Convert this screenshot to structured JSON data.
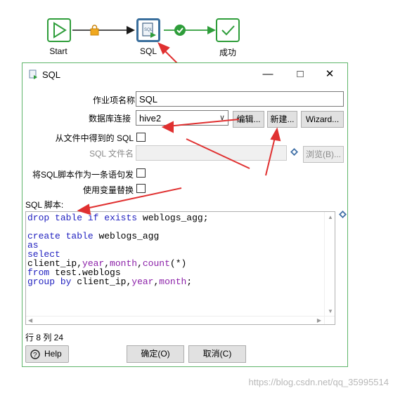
{
  "workflow": {
    "nodes": [
      {
        "label": "Start"
      },
      {
        "label": "SQL"
      },
      {
        "label": "成功"
      }
    ]
  },
  "dialog": {
    "title": "SQL",
    "fields": {
      "job_name_label": "作业项名称",
      "job_name_value": "SQL",
      "db_conn_label": "数据库连接",
      "db_conn_value": "hive2",
      "edit_button": "编辑...",
      "new_button": "新建...",
      "wizard_button": "Wizard...",
      "sql_from_file_label": "从文件中得到的 SQL",
      "sql_filename_label": "SQL 文件名",
      "browse_button": "浏览(B)...",
      "single_statement_label": "将SQL脚本作为一条语句发",
      "use_variables_label": "使用变量替换",
      "script_label": "SQL 脚本:"
    },
    "editor": {
      "lines": [
        [
          [
            "kw",
            "drop"
          ],
          [
            "t",
            " "
          ],
          [
            "kw",
            "table"
          ],
          [
            "t",
            " "
          ],
          [
            "kw",
            "if"
          ],
          [
            "t",
            " "
          ],
          [
            "kw",
            "exists"
          ],
          [
            "t",
            " weblogs_agg;"
          ]
        ],
        [],
        [
          [
            "kw",
            "create"
          ],
          [
            "t",
            " "
          ],
          [
            "kw",
            "table"
          ],
          [
            "t",
            " weblogs_agg"
          ]
        ],
        [
          [
            "kw",
            "as"
          ]
        ],
        [
          [
            "kw",
            "select"
          ]
        ],
        [
          [
            "t",
            "client_ip,"
          ],
          [
            "fn",
            "year"
          ],
          [
            "t",
            ","
          ],
          [
            "fn",
            "month"
          ],
          [
            "t",
            ","
          ],
          [
            "fn",
            "count"
          ],
          [
            "t",
            "(*)"
          ]
        ],
        [
          [
            "kw",
            "from"
          ],
          [
            "t",
            " test.weblogs"
          ]
        ],
        [
          [
            "kw",
            "group"
          ],
          [
            "t",
            " "
          ],
          [
            "kw",
            "by"
          ],
          [
            "t",
            " client_ip,"
          ],
          [
            "fn",
            "year"
          ],
          [
            "t",
            ","
          ],
          [
            "fn",
            "month"
          ],
          [
            "t",
            ";"
          ]
        ]
      ]
    },
    "status": "行 8 列 24",
    "help_button": "Help",
    "ok_button": "确定(O)",
    "cancel_button": "取消(C)"
  },
  "watermark": "https://blog.csdn.net/qq_35995514",
  "colors": {
    "accent_green": "#2e9d3a",
    "arrow_red": "#e03030",
    "keyword_blue": "#1f1fbf",
    "function_purple": "#8b1fa8"
  }
}
